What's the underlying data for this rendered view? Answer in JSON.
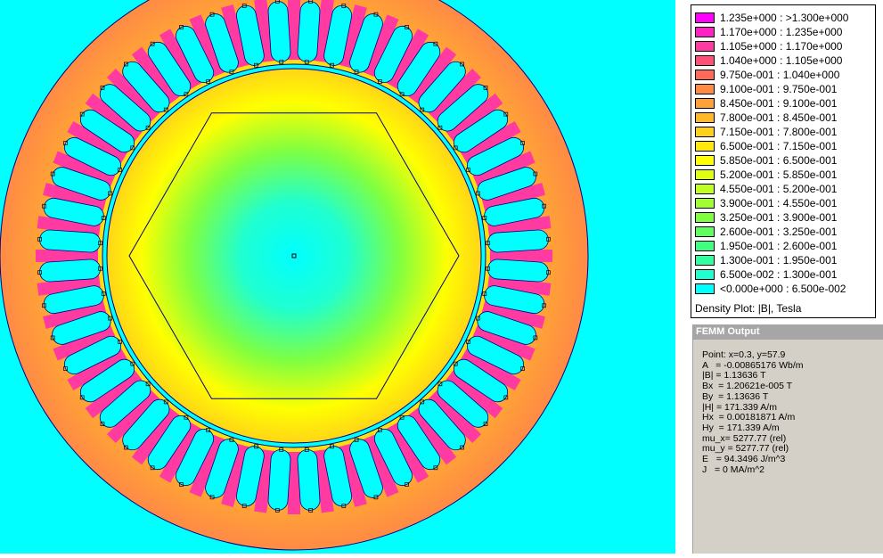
{
  "legend": {
    "entries": [
      {
        "label": "1.235e+000 : >1.300e+000",
        "color": "#ff00ff"
      },
      {
        "label": "1.170e+000 : 1.235e+000",
        "color": "#ff20c8"
      },
      {
        "label": "1.105e+000 : 1.170e+000",
        "color": "#ff3aa0"
      },
      {
        "label": "1.040e+000 : 1.105e+000",
        "color": "#ff5078"
      },
      {
        "label": "9.750e-001 : 1.040e+000",
        "color": "#ff6a5a"
      },
      {
        "label": "9.100e-001 : 9.750e-001",
        "color": "#ff8a46"
      },
      {
        "label": "8.450e-001 : 9.100e-001",
        "color": "#ffa038"
      },
      {
        "label": "7.800e-001 : 8.450e-001",
        "color": "#ffb828"
      },
      {
        "label": "7.150e-001 : 7.800e-001",
        "color": "#ffd01a"
      },
      {
        "label": "6.500e-001 : 7.150e-001",
        "color": "#ffe80a"
      },
      {
        "label": "5.850e-001 : 6.500e-001",
        "color": "#ffff00"
      },
      {
        "label": "5.200e-001 : 5.850e-001",
        "color": "#e0ff10"
      },
      {
        "label": "4.550e-001 : 5.200e-001",
        "color": "#c0ff20"
      },
      {
        "label": "3.900e-001 : 4.550e-001",
        "color": "#a0ff30"
      },
      {
        "label": "3.250e-001 : 3.900e-001",
        "color": "#80ff40"
      },
      {
        "label": "2.600e-001 : 3.250e-001",
        "color": "#60ff60"
      },
      {
        "label": "1.950e-001 : 2.600e-001",
        "color": "#40ff80"
      },
      {
        "label": "1.300e-001 : 1.950e-001",
        "color": "#30ffa0"
      },
      {
        "label": "6.500e-002 : 1.300e-001",
        "color": "#20ffd0"
      },
      {
        "label": "<0.000e+000 : 6.500e-002",
        "color": "#00ffff"
      }
    ],
    "title": "Density Plot: |B|, Tesla"
  },
  "output": {
    "header": "FEMM Output",
    "lines": [
      "Point: x=0.3, y=57.9",
      "A   = -0.00865176 Wb/m",
      "|B| = 1.13636 T",
      "Bx  = 1.20621e-005 T",
      "By  = 1.13636 T",
      "|H| = 171.339 A/m",
      "Hx  = 0.00181871 A/m",
      "Hy  = 171.339 A/m",
      "mu_x= 5277.77 (rel)",
      "mu_y = 5277.77 (rel)",
      "E   = 94.3496 J/m^3",
      "J   = 0 MA/m^2"
    ]
  },
  "colors": {
    "background": "#00ffff",
    "stator_outer": "#ff8a46",
    "stator_mid": "#ffd01a",
    "tooth": "#ff3aa0",
    "rotor_core": "#a0ff30",
    "rotor_center": "#20ffd0",
    "slot": "#00ffff",
    "outline": "#000080"
  }
}
